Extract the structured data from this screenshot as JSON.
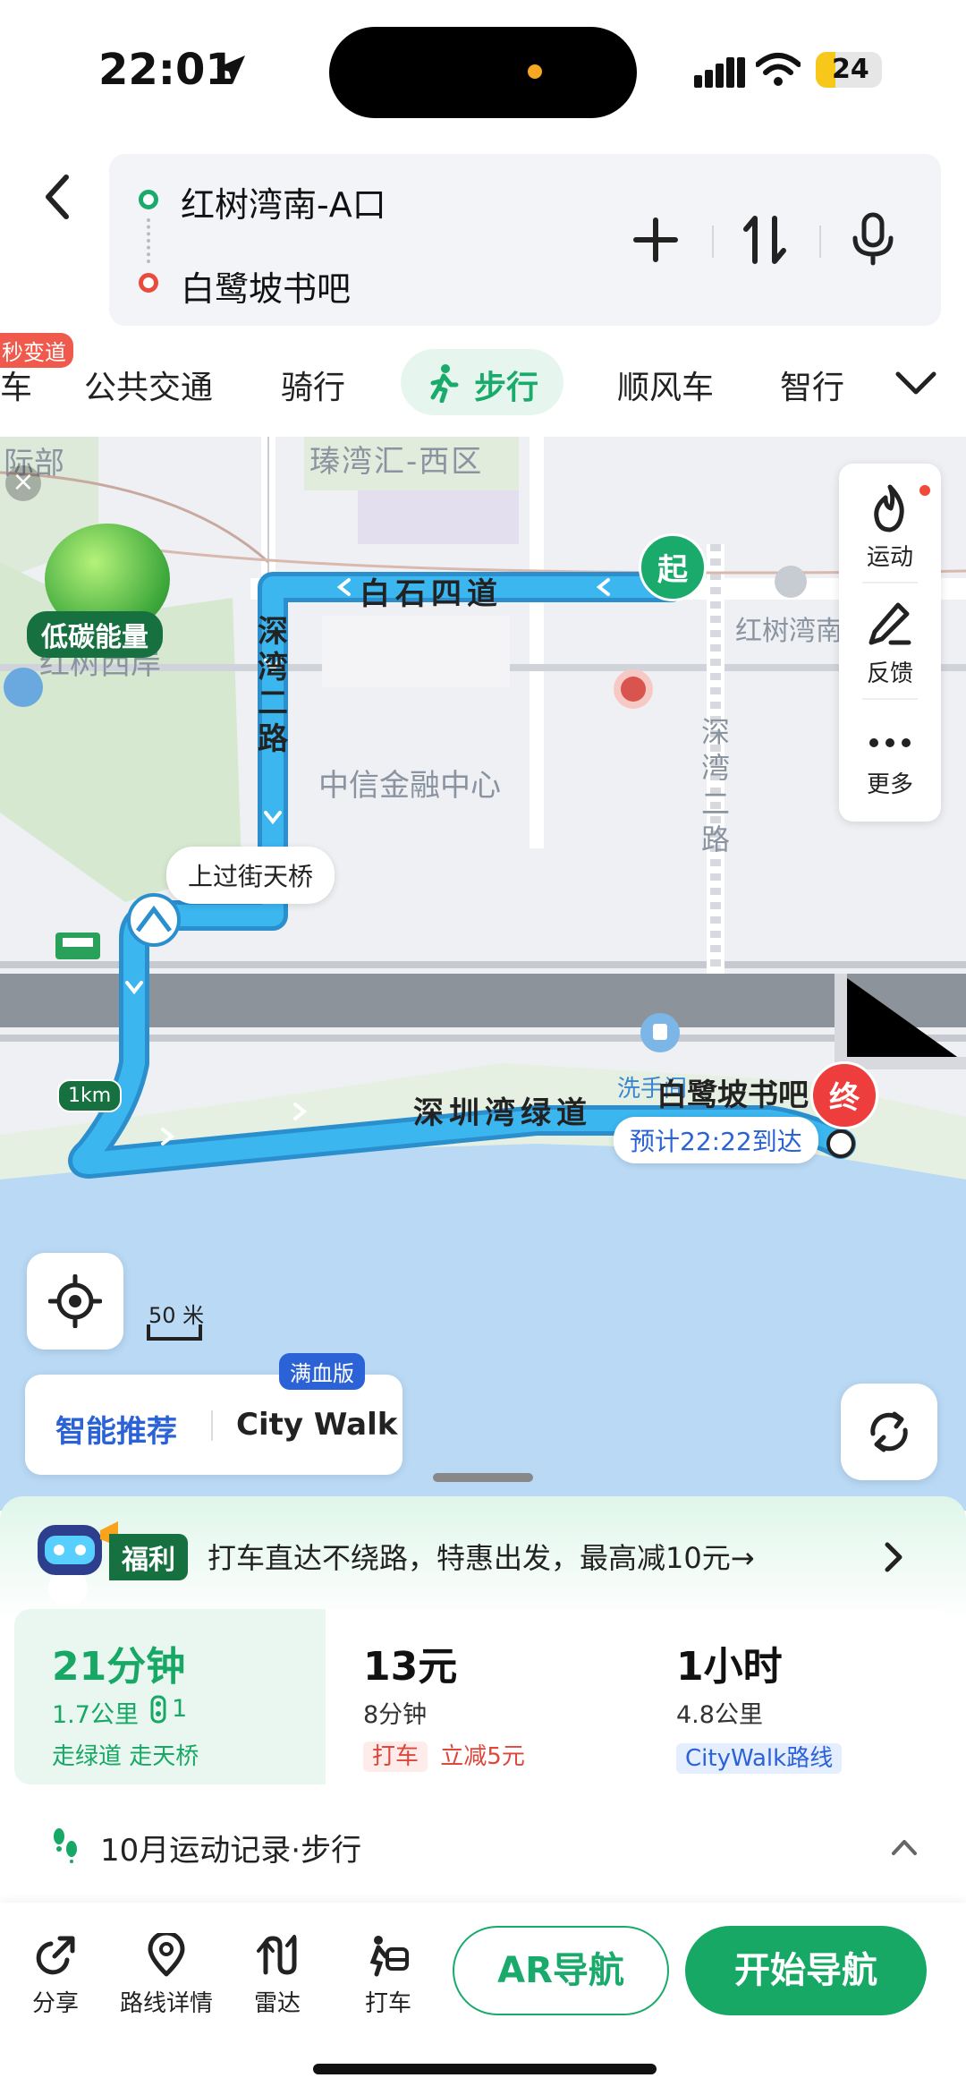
{
  "status_bar": {
    "time": "22:01",
    "battery": "24"
  },
  "search": {
    "from": "红树湾南-A口",
    "to": "白鹭坡书吧"
  },
  "tabs": {
    "items": [
      "车",
      "公共交通",
      "骑行",
      "步行",
      "顺风车",
      "智行"
    ],
    "selected": "步行",
    "badge": "秒变道"
  },
  "map": {
    "labels": {
      "area_top_left": "际部",
      "area_top": "瑧湾汇-西区",
      "west_shore": "红树西岸",
      "center": "中信金融中心",
      "station_right": "红树湾南",
      "road_top": "白石四道",
      "road_left": "深湾二路",
      "road_right": "深湾二路",
      "greenway": "深圳湾绿道",
      "toilet": "洗手间"
    },
    "carbon_label": "低碳能量",
    "overpass_hint": "上过街天桥",
    "km_marker": "1km",
    "start_marker": "起",
    "end_marker": "终",
    "destination": "白鹭坡书吧",
    "eta": "预计22:22到达",
    "scale": "50 米",
    "tools": [
      {
        "label": "运动",
        "icon": "flame-icon"
      },
      {
        "label": "反馈",
        "icon": "pencil-icon"
      },
      {
        "label": "更多",
        "icon": "more-icon"
      }
    ],
    "recommend": {
      "primary": "智能推荐",
      "secondary": "City Walk",
      "badge": "满血版"
    }
  },
  "promo": {
    "tag": "福利",
    "text": "打车直达不绕路，特惠出发，最高减10元→"
  },
  "routes": [
    {
      "time": "21分钟",
      "sub1": "1.7公里",
      "sub2": "1",
      "tag": "走绿道 走天桥"
    },
    {
      "time": "13元",
      "sub1": "8分钟",
      "tag_a": "打车",
      "tag_b": "立减5元"
    },
    {
      "time": "1小时",
      "sub1": "4.8公里",
      "tag": "CityWalk路线"
    }
  ],
  "record": {
    "text": "10月运动记录·步行"
  },
  "bottom_bar": {
    "share": "分享",
    "details": "路线详情",
    "radar": "雷达",
    "taxi": "打车",
    "ar": "AR导航",
    "start": "开始导航"
  },
  "colors": {
    "accent": "#1aaa6b",
    "route": "#2ea8e4",
    "end": "#ee3d3d",
    "link": "#2b63d6"
  }
}
